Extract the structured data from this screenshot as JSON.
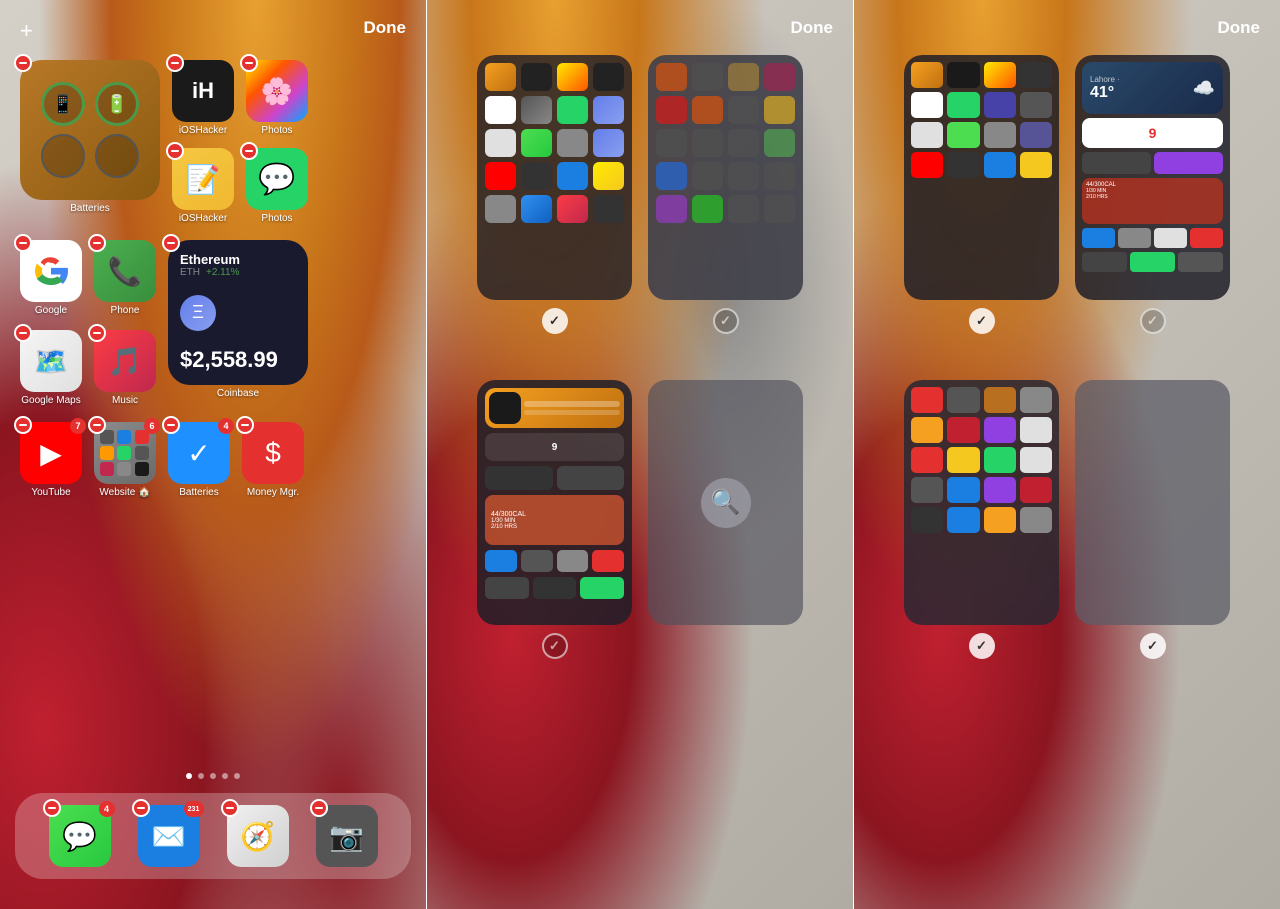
{
  "panels": [
    {
      "id": "panel1",
      "done_label": "Done",
      "plus_label": "+",
      "rows": [
        {
          "items": [
            {
              "id": "batteries",
              "type": "widget",
              "label": "Batteries"
            },
            {
              "id": "ios-hacker",
              "type": "app",
              "label": "iOSHacker",
              "color": "dark"
            },
            {
              "id": "photos",
              "type": "app",
              "label": "Photos",
              "color": "photos"
            }
          ]
        },
        {
          "items": [
            {
              "id": "notes",
              "type": "app",
              "label": "Notes",
              "color": "notes"
            },
            {
              "id": "whatsapp",
              "type": "app",
              "label": "WhatsApp",
              "color": "whatsapp"
            }
          ]
        },
        {
          "items": [
            {
              "id": "google",
              "type": "app",
              "label": "Google",
              "color": "google"
            },
            {
              "id": "phone",
              "type": "app",
              "label": "Phone",
              "color": "phone"
            },
            {
              "id": "coinbase",
              "type": "widget",
              "label": "Coinbase"
            }
          ]
        },
        {
          "items": [
            {
              "id": "maps",
              "type": "app",
              "label": "Google Maps",
              "color": "maps"
            },
            {
              "id": "music",
              "type": "app",
              "label": "Music",
              "color": "music"
            }
          ]
        },
        {
          "items": [
            {
              "id": "youtube",
              "type": "app",
              "label": "YouTube",
              "badge": "7",
              "color": "youtube"
            },
            {
              "id": "website",
              "type": "folder",
              "label": "Website 🏠",
              "badge": "6"
            },
            {
              "id": "things",
              "type": "app",
              "label": "Things",
              "badge": "4",
              "color": "things"
            },
            {
              "id": "money",
              "type": "app",
              "label": "Money Mgr.",
              "color": "money"
            }
          ]
        }
      ],
      "dock": [
        {
          "id": "messages",
          "label": "Messages",
          "badge": "4",
          "color": "messages"
        },
        {
          "id": "mail",
          "label": "Mail",
          "badge": "231",
          "color": "mail"
        },
        {
          "id": "safari",
          "label": "Safari",
          "color": "safari"
        },
        {
          "id": "camera",
          "label": "Camera",
          "color": "camera"
        }
      ],
      "coinbase": {
        "name": "Ethereum",
        "symbol": "ETH",
        "change": "+2.11%",
        "price": "$2,558.99"
      }
    },
    {
      "id": "panel2",
      "done_label": "Done",
      "screens": [
        {
          "position": "top-left",
          "type": "app-grid",
          "selected": true
        },
        {
          "position": "top-right",
          "type": "app-grid",
          "selected": false
        },
        {
          "position": "bottom-left",
          "type": "widgets",
          "selected": false
        },
        {
          "position": "bottom-right",
          "type": "empty",
          "selected": false
        }
      ]
    },
    {
      "id": "panel3",
      "done_label": "Done",
      "screens": [
        {
          "position": "top-left",
          "type": "app-grid",
          "selected": true
        },
        {
          "position": "top-right",
          "type": "widgets-large",
          "selected": false
        },
        {
          "position": "bottom-left",
          "type": "app-grid-2",
          "selected": false
        },
        {
          "position": "bottom-right",
          "type": "empty",
          "selected": false
        }
      ]
    }
  ],
  "dots": 5,
  "active_dot": 0
}
